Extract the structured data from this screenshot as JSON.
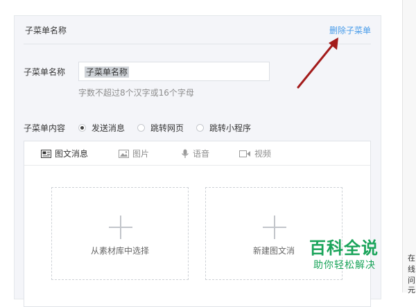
{
  "panel": {
    "title": "子菜单名称",
    "delete_label": "删除子菜单"
  },
  "form": {
    "name_label": "子菜单名称",
    "name_value": "子菜单名称",
    "name_hint": "字数不超过8个汉字或16个字母",
    "content_label": "子菜单内容",
    "content_options": [
      {
        "label": "发送消息",
        "checked": true
      },
      {
        "label": "跳转网页",
        "checked": false
      },
      {
        "label": "跳转小程序",
        "checked": false
      }
    ]
  },
  "editor": {
    "tabs": [
      {
        "label": "图文消息",
        "icon": "news-icon",
        "active": true
      },
      {
        "label": "图片",
        "icon": "image-icon",
        "active": false
      },
      {
        "label": "语音",
        "icon": "microphone-icon",
        "active": false
      },
      {
        "label": "视频",
        "icon": "video-icon",
        "active": false
      }
    ],
    "select_from_library": "从素材库中选择",
    "create_new": "新建图文消"
  },
  "right_sidebar": {
    "snippets": [
      "在",
      "线",
      "问",
      "元"
    ]
  },
  "watermark": {
    "title": "百科全说",
    "subtitle": "助你轻松解决"
  },
  "colors": {
    "accent_link": "#459ae9",
    "annotation_arrow": "#a31b1b",
    "watermark_green": "#1aa45a"
  }
}
